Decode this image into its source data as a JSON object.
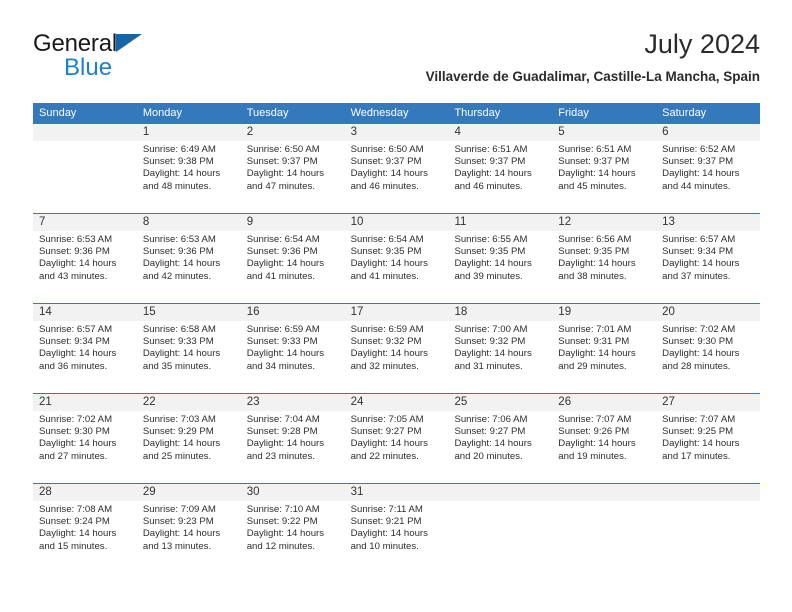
{
  "logo": {
    "text_primary": "General",
    "text_secondary": "Blue",
    "triangle_icon": "triangle-icon",
    "color_primary": "#1a1a1a",
    "color_secondary": "#1b7fd4"
  },
  "header": {
    "title": "July 2024",
    "subtitle": "Villaverde de Guadalimar, Castille-La Mancha, Spain"
  },
  "colors": {
    "header_blue": "#3579bd",
    "day_band_gray": "#f2f2f2",
    "text": "#2e2e2e"
  },
  "weekdays": [
    "Sunday",
    "Monday",
    "Tuesday",
    "Wednesday",
    "Thursday",
    "Friday",
    "Saturday"
  ],
  "weeks": [
    [
      {
        "day": "",
        "sunrise": "",
        "sunset": "",
        "daylight_line1": "",
        "daylight_line2": ""
      },
      {
        "day": "1",
        "sunrise": "Sunrise: 6:49 AM",
        "sunset": "Sunset: 9:38 PM",
        "daylight_line1": "Daylight: 14 hours",
        "daylight_line2": "and 48 minutes."
      },
      {
        "day": "2",
        "sunrise": "Sunrise: 6:50 AM",
        "sunset": "Sunset: 9:37 PM",
        "daylight_line1": "Daylight: 14 hours",
        "daylight_line2": "and 47 minutes."
      },
      {
        "day": "3",
        "sunrise": "Sunrise: 6:50 AM",
        "sunset": "Sunset: 9:37 PM",
        "daylight_line1": "Daylight: 14 hours",
        "daylight_line2": "and 46 minutes."
      },
      {
        "day": "4",
        "sunrise": "Sunrise: 6:51 AM",
        "sunset": "Sunset: 9:37 PM",
        "daylight_line1": "Daylight: 14 hours",
        "daylight_line2": "and 46 minutes."
      },
      {
        "day": "5",
        "sunrise": "Sunrise: 6:51 AM",
        "sunset": "Sunset: 9:37 PM",
        "daylight_line1": "Daylight: 14 hours",
        "daylight_line2": "and 45 minutes."
      },
      {
        "day": "6",
        "sunrise": "Sunrise: 6:52 AM",
        "sunset": "Sunset: 9:37 PM",
        "daylight_line1": "Daylight: 14 hours",
        "daylight_line2": "and 44 minutes."
      }
    ],
    [
      {
        "day": "7",
        "sunrise": "Sunrise: 6:53 AM",
        "sunset": "Sunset: 9:36 PM",
        "daylight_line1": "Daylight: 14 hours",
        "daylight_line2": "and 43 minutes."
      },
      {
        "day": "8",
        "sunrise": "Sunrise: 6:53 AM",
        "sunset": "Sunset: 9:36 PM",
        "daylight_line1": "Daylight: 14 hours",
        "daylight_line2": "and 42 minutes."
      },
      {
        "day": "9",
        "sunrise": "Sunrise: 6:54 AM",
        "sunset": "Sunset: 9:36 PM",
        "daylight_line1": "Daylight: 14 hours",
        "daylight_line2": "and 41 minutes."
      },
      {
        "day": "10",
        "sunrise": "Sunrise: 6:54 AM",
        "sunset": "Sunset: 9:35 PM",
        "daylight_line1": "Daylight: 14 hours",
        "daylight_line2": "and 41 minutes."
      },
      {
        "day": "11",
        "sunrise": "Sunrise: 6:55 AM",
        "sunset": "Sunset: 9:35 PM",
        "daylight_line1": "Daylight: 14 hours",
        "daylight_line2": "and 39 minutes."
      },
      {
        "day": "12",
        "sunrise": "Sunrise: 6:56 AM",
        "sunset": "Sunset: 9:35 PM",
        "daylight_line1": "Daylight: 14 hours",
        "daylight_line2": "and 38 minutes."
      },
      {
        "day": "13",
        "sunrise": "Sunrise: 6:57 AM",
        "sunset": "Sunset: 9:34 PM",
        "daylight_line1": "Daylight: 14 hours",
        "daylight_line2": "and 37 minutes."
      }
    ],
    [
      {
        "day": "14",
        "sunrise": "Sunrise: 6:57 AM",
        "sunset": "Sunset: 9:34 PM",
        "daylight_line1": "Daylight: 14 hours",
        "daylight_line2": "and 36 minutes."
      },
      {
        "day": "15",
        "sunrise": "Sunrise: 6:58 AM",
        "sunset": "Sunset: 9:33 PM",
        "daylight_line1": "Daylight: 14 hours",
        "daylight_line2": "and 35 minutes."
      },
      {
        "day": "16",
        "sunrise": "Sunrise: 6:59 AM",
        "sunset": "Sunset: 9:33 PM",
        "daylight_line1": "Daylight: 14 hours",
        "daylight_line2": "and 34 minutes."
      },
      {
        "day": "17",
        "sunrise": "Sunrise: 6:59 AM",
        "sunset": "Sunset: 9:32 PM",
        "daylight_line1": "Daylight: 14 hours",
        "daylight_line2": "and 32 minutes."
      },
      {
        "day": "18",
        "sunrise": "Sunrise: 7:00 AM",
        "sunset": "Sunset: 9:32 PM",
        "daylight_line1": "Daylight: 14 hours",
        "daylight_line2": "and 31 minutes."
      },
      {
        "day": "19",
        "sunrise": "Sunrise: 7:01 AM",
        "sunset": "Sunset: 9:31 PM",
        "daylight_line1": "Daylight: 14 hours",
        "daylight_line2": "and 29 minutes."
      },
      {
        "day": "20",
        "sunrise": "Sunrise: 7:02 AM",
        "sunset": "Sunset: 9:30 PM",
        "daylight_line1": "Daylight: 14 hours",
        "daylight_line2": "and 28 minutes."
      }
    ],
    [
      {
        "day": "21",
        "sunrise": "Sunrise: 7:02 AM",
        "sunset": "Sunset: 9:30 PM",
        "daylight_line1": "Daylight: 14 hours",
        "daylight_line2": "and 27 minutes."
      },
      {
        "day": "22",
        "sunrise": "Sunrise: 7:03 AM",
        "sunset": "Sunset: 9:29 PM",
        "daylight_line1": "Daylight: 14 hours",
        "daylight_line2": "and 25 minutes."
      },
      {
        "day": "23",
        "sunrise": "Sunrise: 7:04 AM",
        "sunset": "Sunset: 9:28 PM",
        "daylight_line1": "Daylight: 14 hours",
        "daylight_line2": "and 23 minutes."
      },
      {
        "day": "24",
        "sunrise": "Sunrise: 7:05 AM",
        "sunset": "Sunset: 9:27 PM",
        "daylight_line1": "Daylight: 14 hours",
        "daylight_line2": "and 22 minutes."
      },
      {
        "day": "25",
        "sunrise": "Sunrise: 7:06 AM",
        "sunset": "Sunset: 9:27 PM",
        "daylight_line1": "Daylight: 14 hours",
        "daylight_line2": "and 20 minutes."
      },
      {
        "day": "26",
        "sunrise": "Sunrise: 7:07 AM",
        "sunset": "Sunset: 9:26 PM",
        "daylight_line1": "Daylight: 14 hours",
        "daylight_line2": "and 19 minutes."
      },
      {
        "day": "27",
        "sunrise": "Sunrise: 7:07 AM",
        "sunset": "Sunset: 9:25 PM",
        "daylight_line1": "Daylight: 14 hours",
        "daylight_line2": "and 17 minutes."
      }
    ],
    [
      {
        "day": "28",
        "sunrise": "Sunrise: 7:08 AM",
        "sunset": "Sunset: 9:24 PM",
        "daylight_line1": "Daylight: 14 hours",
        "daylight_line2": "and 15 minutes."
      },
      {
        "day": "29",
        "sunrise": "Sunrise: 7:09 AM",
        "sunset": "Sunset: 9:23 PM",
        "daylight_line1": "Daylight: 14 hours",
        "daylight_line2": "and 13 minutes."
      },
      {
        "day": "30",
        "sunrise": "Sunrise: 7:10 AM",
        "sunset": "Sunset: 9:22 PM",
        "daylight_line1": "Daylight: 14 hours",
        "daylight_line2": "and 12 minutes."
      },
      {
        "day": "31",
        "sunrise": "Sunrise: 7:11 AM",
        "sunset": "Sunset: 9:21 PM",
        "daylight_line1": "Daylight: 14 hours",
        "daylight_line2": "and 10 minutes."
      },
      {
        "day": "",
        "sunrise": "",
        "sunset": "",
        "daylight_line1": "",
        "daylight_line2": ""
      },
      {
        "day": "",
        "sunrise": "",
        "sunset": "",
        "daylight_line1": "",
        "daylight_line2": ""
      },
      {
        "day": "",
        "sunrise": "",
        "sunset": "",
        "daylight_line1": "",
        "daylight_line2": ""
      }
    ]
  ]
}
